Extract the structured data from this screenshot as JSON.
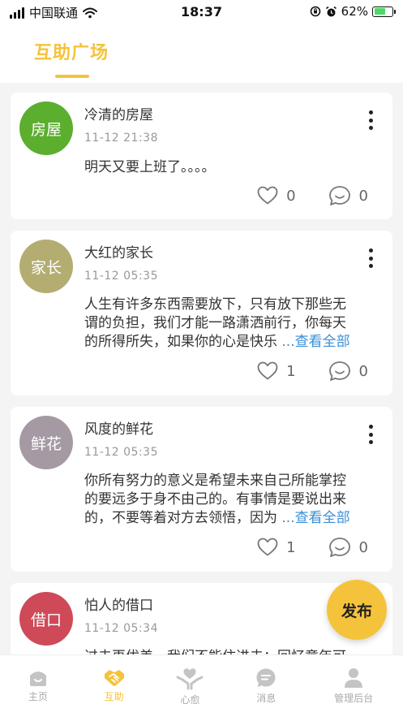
{
  "status_bar": {
    "carrier": "中国联通",
    "time": "18:37",
    "battery": "62%",
    "battery_level": 0.62
  },
  "header": {
    "title": "互助广场"
  },
  "posts": [
    {
      "avatar_text": "房屋",
      "avatar_color": "#5cae2f",
      "name": "冷清的房屋",
      "time": "11-12 21:38",
      "content_lines": [
        "明天又要上班了。。。。"
      ],
      "view_all": "",
      "likes": "0",
      "comments": "0"
    },
    {
      "avatar_text": "家长",
      "avatar_color": "#b4ad71",
      "name": "大红的家长",
      "time": "11-12 05:35",
      "content_lines": [
        "人生有许多东西需要放下，只有放下那些无",
        "谓的负担，我们才能一路潇洒前行，你每天",
        "的所得所失，如果你的心是快乐"
      ],
      "view_all": "...查看全部",
      "likes": "1",
      "comments": "0"
    },
    {
      "avatar_text": "鲜花",
      "avatar_color": "#a59aa3",
      "name": "风度的鲜花",
      "time": "11-12 05:35",
      "content_lines": [
        "你所有努力的意义是希望未来自己所能掌控",
        "的要远多于身不由己的。有事情是要说出来",
        "的，不要等着对方去领悟，因为"
      ],
      "view_all": "...查看全部",
      "likes": "1",
      "comments": "0"
    },
    {
      "avatar_text": "借口",
      "avatar_color": "#cf4a58",
      "name": "怕人的借口",
      "time": "11-12 05:34",
      "content_lines": [
        "过去再优美，我们不能住进去；回忆童年可"
      ],
      "view_all": "",
      "likes": "",
      "comments": ""
    }
  ],
  "fab": {
    "label": "发布"
  },
  "tabbar": [
    {
      "label": "主页",
      "icon": "home-icon",
      "active": false
    },
    {
      "label": "互助",
      "icon": "handshake-icon",
      "active": true
    },
    {
      "label": "心愈",
      "icon": "heart-hands-icon",
      "active": false
    },
    {
      "label": "消息",
      "icon": "message-icon",
      "active": false
    },
    {
      "label": "管理后台",
      "icon": "admin-user-icon",
      "active": false
    }
  ],
  "colors": {
    "accent": "#f5c33b",
    "link": "#3a8fd8"
  }
}
